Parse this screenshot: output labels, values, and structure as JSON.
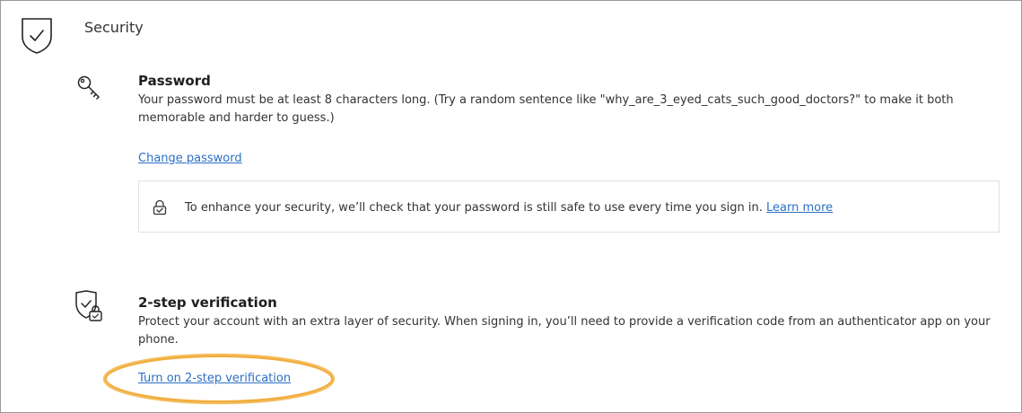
{
  "header": {
    "title": "Security",
    "icon": "shield-check-icon"
  },
  "password": {
    "icon": "key-icon",
    "title": "Password",
    "description": "Your password must be at least 8 characters long. (Try a random sentence like \"why_are_3_eyed_cats_such_good_doctors?\" to make it both memorable and harder to guess.)",
    "change_link": "Change password",
    "notice": {
      "icon": "lock-check-icon",
      "text": "To enhance your security, we’ll check that your password is still safe to use every time you sign in.",
      "learn_more": "Learn more"
    }
  },
  "two_step": {
    "icon": "shield-lock-icon",
    "title": "2-step verification",
    "description": "Protect your account with an extra layer of security. When signing in, you’ll need to provide a verification code from an authenticator app on your phone.",
    "turn_on_link": "Turn on 2-step verification"
  },
  "colors": {
    "link": "#2c6fc4",
    "highlight": "#f0a52a",
    "border": "#9a9a9a"
  }
}
